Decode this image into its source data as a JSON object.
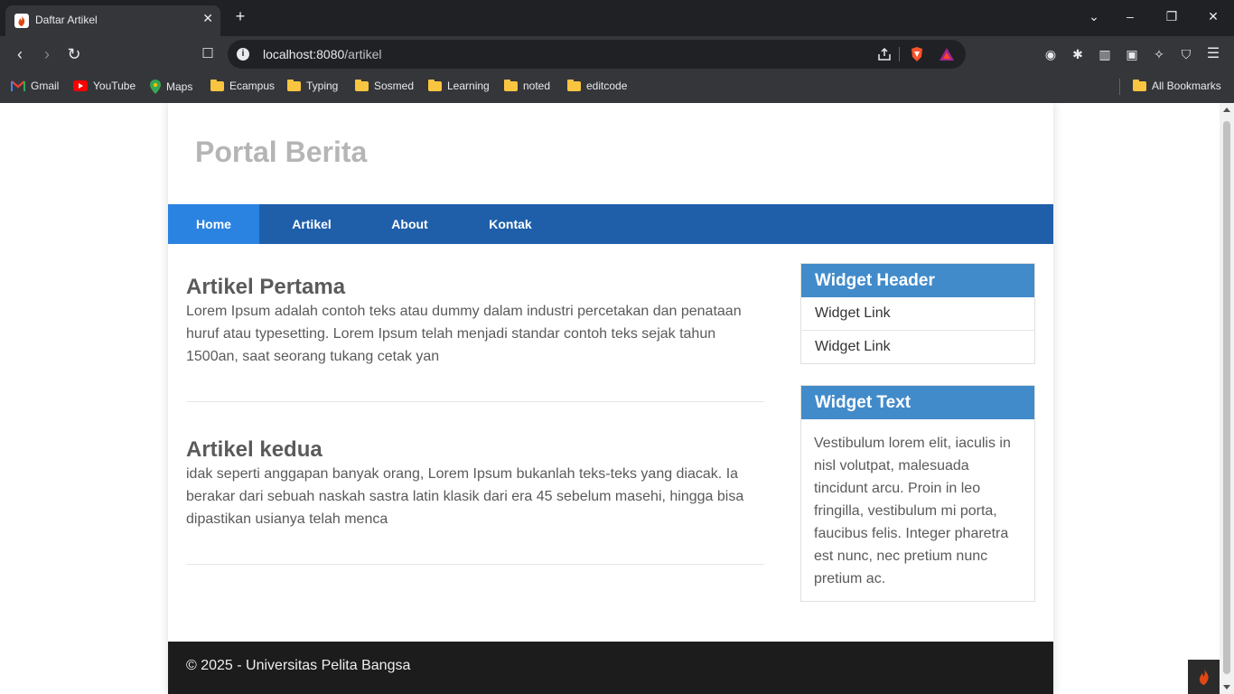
{
  "browser": {
    "tab_title": "Daftar Artikel",
    "new_tab_symbol": "+",
    "url_host": "localhost:8080",
    "url_path": "/artikel",
    "bookmarks": [
      "Gmail",
      "YouTube",
      "Maps",
      "Ecampus",
      "Typing",
      "Sosmed",
      "Learning",
      "noted",
      "editcode"
    ],
    "all_bookmarks": "All Bookmarks"
  },
  "site": {
    "title": "Portal Berita",
    "nav": [
      "Home",
      "Artikel",
      "About",
      "Kontak"
    ],
    "nav_active": "Home"
  },
  "articles": [
    {
      "title": "Artikel Pertama",
      "body": "Lorem Ipsum adalah contoh teks atau dummy dalam industri percetakan dan penataan huruf atau typesetting. Lorem Ipsum telah menjadi standar contoh teks sejak tahun 1500an, saat seorang tukang cetak yan"
    },
    {
      "title": "Artikel kedua",
      "body": "idak seperti anggapan banyak orang, Lorem Ipsum bukanlah teks-teks yang diacak. Ia berakar dari sebuah naskah sastra latin klasik dari era 45 sebelum masehi, hingga bisa dipastikan usianya telah menca"
    }
  ],
  "sidebar": {
    "widget1": {
      "header": "Widget Header",
      "links": [
        "Widget Link",
        "Widget Link"
      ]
    },
    "widget2": {
      "header": "Widget Text",
      "text": "Vestibulum lorem elit, iaculis in nisl volutpat, malesuada tincidunt arcu. Proin in leo fringilla, vestibulum mi porta, faucibus felis. Integer pharetra est nunc, nec pretium nunc pretium ac."
    }
  },
  "footer": {
    "text": "© 2025 - Universitas Pelita Bangsa"
  },
  "colors": {
    "nav": "#1f5faa",
    "nav_active": "#2b83e1",
    "widget_header": "#428bca",
    "footer": "#1c1c1c"
  }
}
